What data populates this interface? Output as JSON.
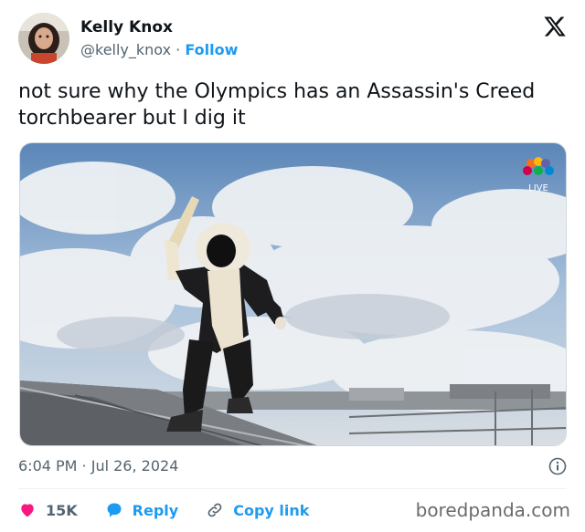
{
  "author": {
    "name": "Kelly Knox",
    "handle": "@kelly_knox",
    "separator": "·",
    "follow_label": "Follow"
  },
  "tweet": {
    "text": "not sure why the Olympics has an Assassin's Creed torchbearer but I dig it",
    "timestamp": "6:04 PM · Jul 26, 2024"
  },
  "media": {
    "broadcast_badge": "LIVE",
    "badge_icon": "nbc-peacock-icon"
  },
  "actions": {
    "likes_count": "15K",
    "reply_label": "Reply",
    "copy_label": "Copy link"
  },
  "watermark": "boredpanda.com",
  "colors": {
    "accent": "#1d9bf0",
    "like": "#f91880",
    "text": "#0f1419",
    "muted": "#536471"
  }
}
